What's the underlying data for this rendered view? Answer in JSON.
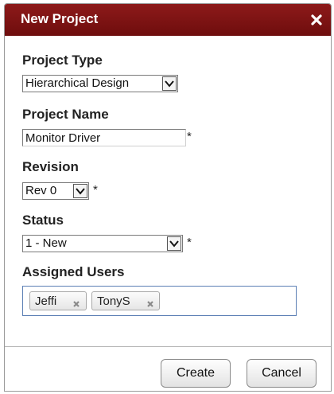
{
  "dialog": {
    "title": "New Project",
    "close_icon": "close-icon"
  },
  "form": {
    "project_type": {
      "label": "Project Type",
      "value": "Hierarchical Design"
    },
    "project_name": {
      "label": "Project Name",
      "value": "Monitor Driver",
      "required_mark": "*"
    },
    "revision": {
      "label": "Revision",
      "value": "Rev 0",
      "required_mark": "*"
    },
    "status": {
      "label": "Status",
      "value": "1 - New",
      "required_mark": "*"
    },
    "assigned_users": {
      "label": "Assigned Users",
      "users": [
        "Jeffi",
        "TonyS"
      ]
    }
  },
  "buttons": {
    "create": "Create",
    "cancel": "Cancel"
  },
  "colors": {
    "titlebar": "#7a1212",
    "focus_border": "#5b7fb4"
  }
}
